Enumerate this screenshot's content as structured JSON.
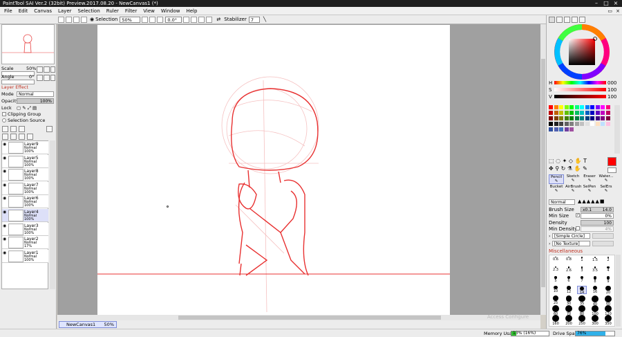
{
  "app": {
    "title": "PaintTool SAI Ver.2 (32bit) Preview.2017.08.20 - NewCanvas1 (*)"
  },
  "menu": [
    "File",
    "Edit",
    "Canvas",
    "Layer",
    "Selection",
    "Ruler",
    "Filter",
    "View",
    "Window",
    "Help"
  ],
  "toolbar": {
    "selection_label": "Selection",
    "zoom": "50%",
    "rotation": "0.0°",
    "stabilizer_label": "Stabilizer",
    "stabilizer_value": "7"
  },
  "navigator": {
    "scale_label": "Scale",
    "scale_value": "50%",
    "angle_label": "Angle",
    "angle_value": "0°"
  },
  "layer_panel": {
    "layer_effect": "Layer Effect",
    "mode_label": "Mode",
    "mode_value": "Normal",
    "opacity_label": "Opacity",
    "opacity_value": "100%",
    "lock_label": "Lock",
    "clipping_group": "Clipping Group",
    "selection_source": "Selection Source"
  },
  "layers": [
    {
      "name": "Layer9",
      "mode": "Normal",
      "opacity": "100%",
      "selected": false
    },
    {
      "name": "Layer5",
      "mode": "Normal",
      "opacity": "100%",
      "selected": false
    },
    {
      "name": "Layer8",
      "mode": "Normal",
      "opacity": "100%",
      "selected": false
    },
    {
      "name": "Layer7",
      "mode": "Normal",
      "opacity": "100%",
      "selected": false
    },
    {
      "name": "Layer6",
      "mode": "Normal",
      "opacity": "100%",
      "selected": false
    },
    {
      "name": "Layer4",
      "mode": "Normal",
      "opacity": "100%",
      "selected": true
    },
    {
      "name": "Layer3",
      "mode": "Normal",
      "opacity": "100%",
      "selected": false
    },
    {
      "name": "Layer2",
      "mode": "Normal",
      "opacity": "17%",
      "selected": false
    },
    {
      "name": "Layer1",
      "mode": "Normal",
      "opacity": "100%",
      "selected": false
    }
  ],
  "canvas_tab": {
    "name": "NewCanvas1",
    "zoom": "50%"
  },
  "status": {
    "memory_label": "Memory Usage",
    "memory_value": "13% (16%)",
    "drive_label": "Drive Space",
    "drive_value": "76%",
    "memory_fraction": 0.13,
    "drive_fraction": 0.76,
    "watermark": "Access Configure"
  },
  "color": {
    "current": "#ff0000",
    "h_label": "H",
    "h_value": "000",
    "s_label": "S",
    "s_value": "100",
    "v_label": "V",
    "v_value": "100"
  },
  "palette": [
    "#ff0000",
    "#ff8000",
    "#ffff00",
    "#80ff00",
    "#00ff00",
    "#00ff80",
    "#00ffff",
    "#0080ff",
    "#0000ff",
    "#8000ff",
    "#ff00ff",
    "#ff0080",
    "#c00000",
    "#c06000",
    "#c0c000",
    "#60c000",
    "#00c000",
    "#00c060",
    "#00c0c0",
    "#0060c0",
    "#0000c0",
    "#6000c0",
    "#c000c0",
    "#c00060",
    "#800000",
    "#804000",
    "#808000",
    "#408000",
    "#008000",
    "#008040",
    "#008080",
    "#004080",
    "#000080",
    "#400080",
    "#800080",
    "#800040",
    "#000000",
    "#202020",
    "#404040",
    "#606060",
    "#808080",
    "#a0a0a0",
    "#c0c0c0",
    "#e0e0e0",
    "#ffffff",
    "#ffe0c0",
    "#c0e0ff",
    "#ffc0e0",
    "#3050a0",
    "#5060b0",
    "#4070c0",
    "#7040a0",
    "#a050a0"
  ],
  "tools": [
    "Pencil",
    "Sketch",
    "Eraser",
    "Water...",
    "Bucket",
    "AirBrush",
    "SelPen",
    "SelErs"
  ],
  "brush": {
    "blend_mode": "Normal",
    "size_label": "Brush Size",
    "size_mult": "x0.1",
    "size_value": "14.0",
    "min_size_label": "Min Size",
    "min_size_value": "0%",
    "density_label": "Density",
    "density_value": "100",
    "min_density_label": "Min Density",
    "min_density_value": "4%",
    "shape": "[Simple Circle]",
    "texture": "[No Texture]",
    "misc": "Miscellaneous"
  },
  "brush_sizes": [
    "0.6",
    "0.8",
    "1",
    "1.5",
    "2",
    "2.3",
    "2.6",
    "3",
    "3.5",
    "4",
    "5",
    "6",
    "7",
    "8",
    "9",
    "10",
    "12",
    "14",
    "16",
    "20",
    "25",
    "30",
    "35",
    "40",
    "50",
    "60",
    "70",
    "80",
    "100",
    "120",
    "160",
    "200",
    "250",
    "300",
    "350"
  ]
}
